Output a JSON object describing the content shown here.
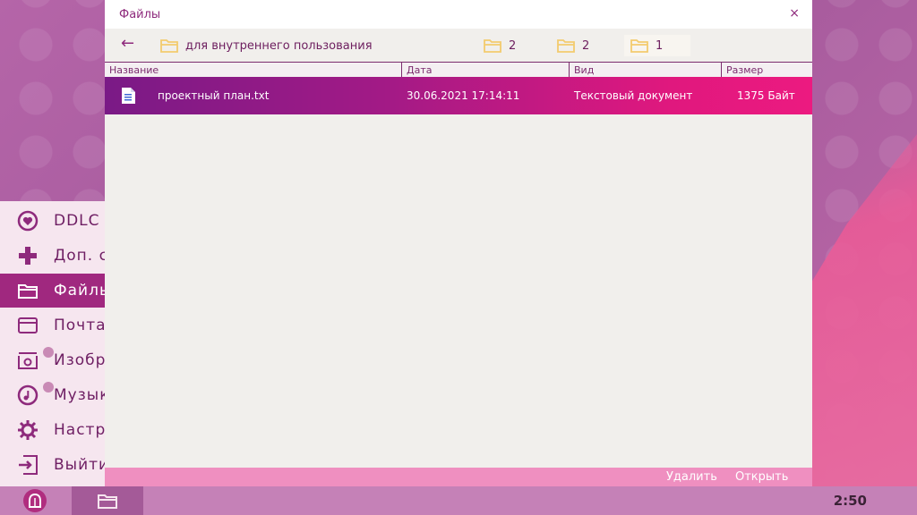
{
  "window": {
    "title": "Файлы",
    "close_symbol": "×"
  },
  "toolbar": {
    "back_symbol": "←",
    "path": [
      {
        "label": "для внутреннего пользования",
        "icon": "folder-icon"
      },
      {
        "label": "2",
        "icon": "folder-icon"
      },
      {
        "label": "2",
        "icon": "folder-icon"
      },
      {
        "label": "1",
        "icon": "folder-icon",
        "selected": true
      }
    ]
  },
  "columns": {
    "name": "Название",
    "date": "Дата",
    "type": "Вид",
    "size": "Размер"
  },
  "files": [
    {
      "name": "проектный план.txt",
      "date": "30.06.2021 17:14:11",
      "type": "Текстовый документ",
      "size": "1375 Байт",
      "icon": "text-file-icon"
    }
  ],
  "actions": {
    "delete": "Удалить",
    "open": "Открыть"
  },
  "start_menu": {
    "items": [
      {
        "label": "DDLC",
        "icon": "heart-icon"
      },
      {
        "label": "Доп. с",
        "icon": "plus-icon"
      },
      {
        "label": "Файль",
        "icon": "folder-icon",
        "active": true
      },
      {
        "label": "Почта",
        "icon": "mail-icon"
      },
      {
        "label": "Изобр",
        "icon": "image-icon",
        "badge": true
      },
      {
        "label": "Музык",
        "icon": "music-icon",
        "badge": true
      },
      {
        "label": "Настро",
        "icon": "gear-icon"
      },
      {
        "label": "Выйти",
        "icon": "exit-icon"
      }
    ]
  },
  "taskbar": {
    "clock": "2:50"
  },
  "colors": {
    "accent": "#8e2a7c",
    "row_gradient_start": "#7a1a86",
    "row_gradient_end": "#ec1a80",
    "folder_yellow": "#f3cb6e",
    "bottom_bar": "#ef8fc0"
  }
}
